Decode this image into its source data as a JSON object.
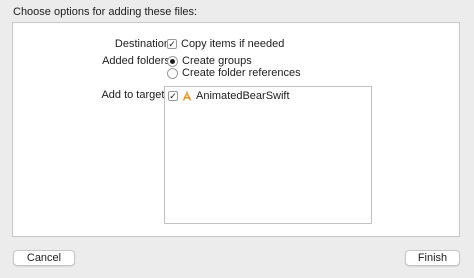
{
  "header": {
    "title": "Choose options for adding these files:"
  },
  "options": {
    "destination": {
      "label": "Destination:",
      "checkbox_label": "Copy items if needed",
      "checked": true
    },
    "added_folders": {
      "label": "Added folders:",
      "options": [
        {
          "label": "Create groups",
          "selected": true
        },
        {
          "label": "Create folder references",
          "selected": false
        }
      ]
    },
    "add_to_targets": {
      "label": "Add to targets:",
      "targets": [
        {
          "name": "AnimatedBearSwift",
          "checked": true,
          "icon": "app-target-icon"
        }
      ]
    }
  },
  "footer": {
    "cancel_label": "Cancel",
    "finish_label": "Finish"
  }
}
